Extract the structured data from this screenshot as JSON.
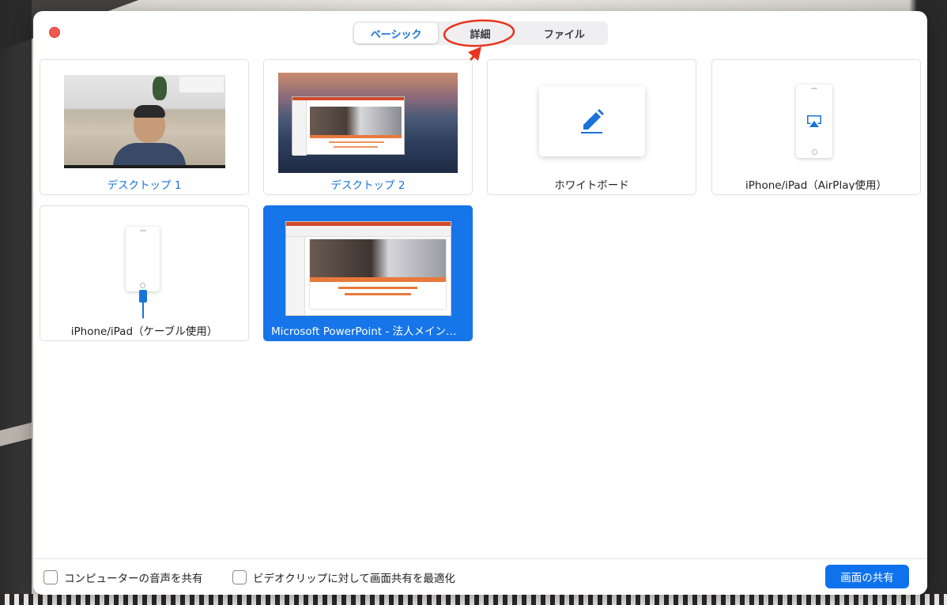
{
  "dialog": {
    "tabs": [
      {
        "label": "ベーシック",
        "active": true
      },
      {
        "label": "詳細",
        "active": false
      },
      {
        "label": "ファイル",
        "active": false
      }
    ]
  },
  "sources": [
    {
      "label": "デスクトップ 1",
      "kind": "desktop",
      "selected": false
    },
    {
      "label": "デスクトップ 2",
      "kind": "desktop",
      "selected": false
    },
    {
      "label": "ホワイトボード",
      "kind": "whiteboard",
      "selected": false
    },
    {
      "label": "iPhone/iPad（AirPlay使用）",
      "kind": "airplay",
      "selected": false
    },
    {
      "label": "iPhone/iPad（ケーブル使用）",
      "kind": "cable",
      "selected": false
    },
    {
      "label": "Microsoft PowerPoint - 法人メインの税理士のための融資株式入門セミナー",
      "kind": "window",
      "selected": true
    }
  ],
  "footer": {
    "share_audio_label": "コンピューターの音声を共有",
    "share_audio_checked": false,
    "optimize_video_label": "ビデオクリップに対して画面共有を最適化",
    "optimize_video_checked": false,
    "share_button_label": "画面の共有"
  },
  "icons": {
    "close": "close-icon",
    "pen": "pen-icon",
    "airplay": "airplay-icon",
    "lightning_cable": "cable-icon"
  },
  "colors": {
    "accent": "#0e72ed",
    "selected_card": "#1675e8",
    "close": "#ee5a52",
    "annotation": "#e8331e"
  }
}
